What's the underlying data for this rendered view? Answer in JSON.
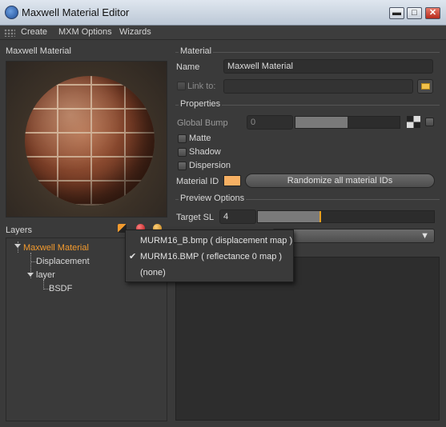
{
  "window": {
    "title": "Maxwell Material Editor",
    "minimize_glyph": "▬",
    "maximize_glyph": "□",
    "close_glyph": "✕"
  },
  "menu": {
    "items": [
      "Create",
      "MXM Options",
      "Wizards"
    ]
  },
  "left": {
    "preview_label": "Maxwell Material",
    "layers_label": "Layers",
    "tree": [
      {
        "label": "Maxwell Material",
        "active": true
      },
      {
        "label": "Displacement",
        "active": false
      },
      {
        "label": "layer",
        "active": false
      },
      {
        "label": "BSDF",
        "active": false
      }
    ]
  },
  "material": {
    "section": "Material",
    "name_label": "Name",
    "name_value": "Maxwell Material",
    "link_label": "Link to:",
    "link_value": ""
  },
  "properties": {
    "section": "Properties",
    "global_bump_label": "Global Bump",
    "global_bump_value": "0",
    "global_bump_fill": 0.5,
    "matte_label": "Matte",
    "shadow_label": "Shadow",
    "dispersion_label": "Dispersion",
    "material_id_label": "Material ID",
    "material_id_color": "#f7b063",
    "randomize_label": "Randomize all material IDs"
  },
  "preview_options": {
    "section": "Preview Options",
    "target_sl_label": "Target SL",
    "target_sl_value": "4",
    "target_sl_fill": 0.35
  },
  "popup": {
    "items": [
      {
        "label": "MURM16_B.bmp ( displacement map )",
        "checked": false
      },
      {
        "label": "MURM16.BMP ( reflectance 0 map )",
        "checked": true
      },
      {
        "label": "(none)",
        "checked": false
      }
    ],
    "check_glyph": "✔"
  },
  "colors": {
    "accent_orange": "#f29a2e",
    "slider_marker": "#e8a020"
  }
}
